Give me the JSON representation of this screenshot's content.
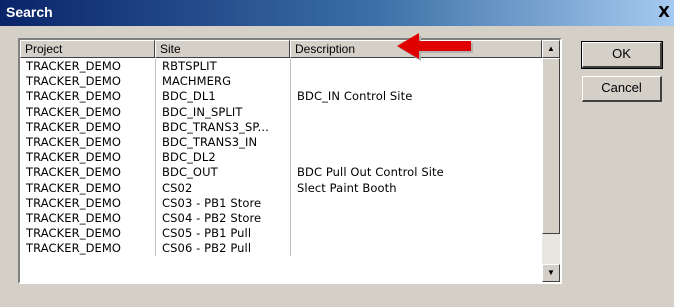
{
  "window": {
    "title": "Search",
    "close_label": "X"
  },
  "columns": {
    "project": "Project",
    "site": "Site",
    "description": "Description"
  },
  "rows": [
    {
      "project": "TRACKER_DEMO",
      "site": "RBTSPLIT",
      "description": ""
    },
    {
      "project": "TRACKER_DEMO",
      "site": "MACHMERG",
      "description": ""
    },
    {
      "project": "TRACKER_DEMO",
      "site": "BDC_DL1",
      "description": "BDC_IN Control Site"
    },
    {
      "project": "TRACKER_DEMO",
      "site": "BDC_IN_SPLIT",
      "description": ""
    },
    {
      "project": "TRACKER_DEMO",
      "site": "BDC_TRANS3_SP...",
      "description": ""
    },
    {
      "project": "TRACKER_DEMO",
      "site": "BDC_TRANS3_IN",
      "description": ""
    },
    {
      "project": "TRACKER_DEMO",
      "site": "BDC_DL2",
      "description": ""
    },
    {
      "project": "TRACKER_DEMO",
      "site": "BDC_OUT",
      "description": "BDC Pull Out Control Site"
    },
    {
      "project": "TRACKER_DEMO",
      "site": "CS02",
      "description": "Slect Paint Booth"
    },
    {
      "project": "TRACKER_DEMO",
      "site": "CS03 - PB1 Store",
      "description": ""
    },
    {
      "project": "TRACKER_DEMO",
      "site": "CS04 - PB2 Store",
      "description": ""
    },
    {
      "project": "TRACKER_DEMO",
      "site": "CS05 - PB1 Pull",
      "description": ""
    },
    {
      "project": "TRACKER_DEMO",
      "site": "CS06 - PB2 Pull",
      "description": ""
    }
  ],
  "buttons": {
    "ok": "OK",
    "cancel": "Cancel"
  },
  "icons": {
    "arrow": "red-arrow-icon",
    "scroll_up": "scroll-up-icon",
    "scroll_down": "scroll-down-icon"
  },
  "colors": {
    "title_start": "#0a246a",
    "title_end": "#a6caf0",
    "arrow": "#e00000",
    "face": "#d4d0c8"
  }
}
